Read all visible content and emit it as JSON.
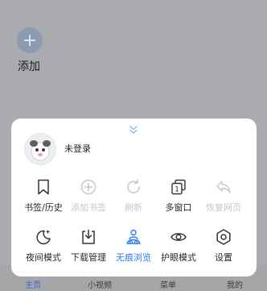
{
  "background": {
    "add_label": "添加",
    "nav": [
      {
        "label": "主页",
        "active": true
      },
      {
        "label": "小视频",
        "active": false
      },
      {
        "label": "菜单",
        "active": false
      },
      {
        "label": "我的",
        "active": false
      }
    ]
  },
  "sheet": {
    "user_label": "未登录",
    "row1": [
      {
        "label": "书签/历史",
        "icon": "bookmark-icon",
        "enabled": true
      },
      {
        "label": "添加书签",
        "icon": "add-bookmark-icon",
        "enabled": false
      },
      {
        "label": "刷新",
        "icon": "refresh-icon",
        "enabled": false
      },
      {
        "label": "多窗口",
        "icon": "multi-window-icon",
        "enabled": true,
        "count": "1"
      },
      {
        "label": "恢复网页",
        "icon": "restore-page-icon",
        "enabled": false
      }
    ],
    "row2": [
      {
        "label": "夜间模式",
        "icon": "night-mode-icon",
        "enabled": true
      },
      {
        "label": "下载管理",
        "icon": "download-icon",
        "enabled": true
      },
      {
        "label": "无痕浏览",
        "icon": "incognito-icon",
        "enabled": true,
        "highlight": true
      },
      {
        "label": "护眼模式",
        "icon": "eye-icon",
        "enabled": true
      },
      {
        "label": "设置",
        "icon": "settings-icon",
        "enabled": true
      }
    ]
  },
  "colors": {
    "accent": "#2b7cf0",
    "disabled": "#c5c7ca",
    "overlay": "#a9abae"
  }
}
